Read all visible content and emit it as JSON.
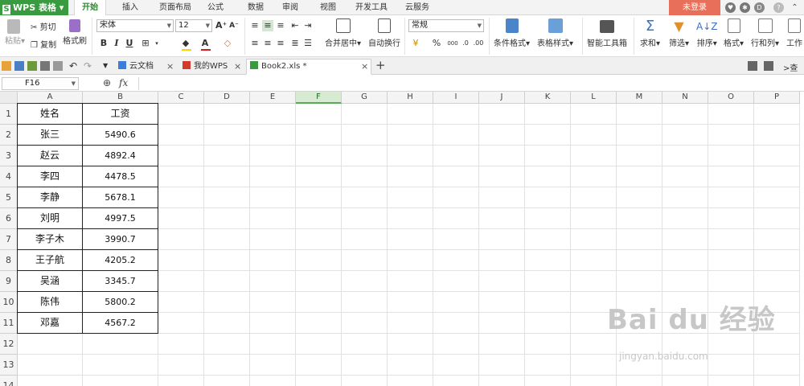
{
  "app": {
    "logo_letter": "S",
    "name": "WPS 表格"
  },
  "menu": {
    "items": [
      "开始",
      "插入",
      "页面布局",
      "公式",
      "数据",
      "审阅",
      "视图",
      "开发工具",
      "云服务"
    ],
    "active_index": 0,
    "login_label": "未登录"
  },
  "ribbon": {
    "paste_label": "粘贴",
    "cut_label": "剪切",
    "copy_label": "复制",
    "format_painter_label": "格式刷",
    "font_name": "宋体",
    "font_size": "12",
    "bold": "B",
    "italic": "I",
    "underline": "U",
    "merge_center_label": "合并居中",
    "wrap_label": "自动换行",
    "number_format": "常规",
    "conditional_format_label": "条件格式",
    "table_style_label": "表格样式",
    "smart_toolbox_label": "智能工具箱",
    "sum_label": "求和",
    "filter_label": "筛选",
    "sort_label": "排序",
    "format_label": "格式",
    "rowcol_label": "行和列",
    "worksheet_label": "工作",
    "percent_label": "%",
    "thousands_label": "000",
    "accent_color": "#3a9a3f",
    "font_color": "#d22020",
    "fill_color": "#f5d50a"
  },
  "tabs": {
    "items": [
      {
        "icon": "cloud-doc-icon",
        "label": "云文档"
      },
      {
        "icon": "wps-icon",
        "label": "我的WPS"
      },
      {
        "icon": "spreadsheet-icon",
        "label": "Book2.xls *"
      }
    ],
    "active_index": 2,
    "right_label": ">查"
  },
  "formula_bar": {
    "cell_ref": "F16",
    "fx_label": "fx",
    "content": ""
  },
  "sheet": {
    "columns": [
      "A",
      "B",
      "C",
      "D",
      "E",
      "F",
      "G",
      "H",
      "I",
      "J",
      "K",
      "L",
      "M",
      "N",
      "O",
      "P"
    ],
    "selected_column": "F",
    "rows": [
      "1",
      "2",
      "3",
      "4",
      "5",
      "6",
      "7",
      "8",
      "9",
      "10",
      "11",
      "12",
      "13",
      "14"
    ],
    "header": [
      "姓名",
      "工资"
    ],
    "data": [
      [
        "张三",
        "5490.6"
      ],
      [
        "赵云",
        "4892.4"
      ],
      [
        "李四",
        "4478.5"
      ],
      [
        "李静",
        "5678.1"
      ],
      [
        "刘明",
        "4997.5"
      ],
      [
        "李子木",
        "3990.7"
      ],
      [
        "王子航",
        "4205.2"
      ],
      [
        "吴涵",
        "3345.7"
      ],
      [
        "陈伟",
        "5800.2"
      ],
      [
        "邓嘉",
        "4567.2"
      ]
    ]
  },
  "watermark": {
    "text": "Bai du 经验",
    "subtext": "jingyan.baidu.com"
  }
}
